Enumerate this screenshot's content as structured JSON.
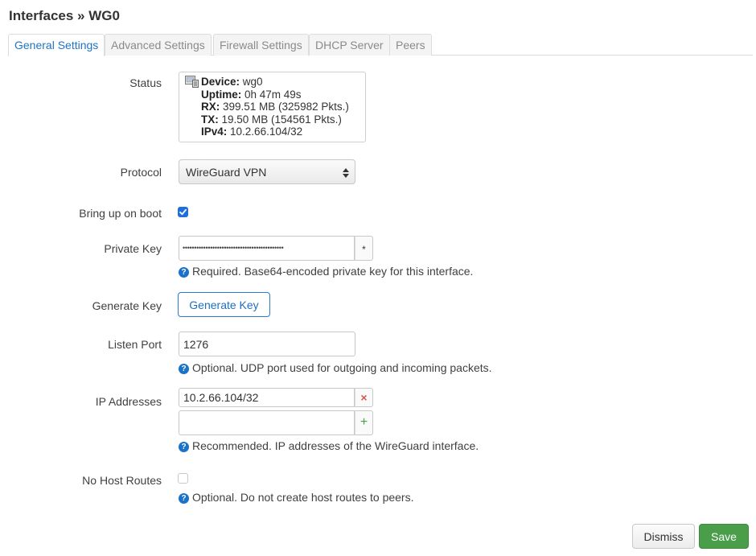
{
  "page": {
    "title": "Interfaces » WG0"
  },
  "tabs": [
    {
      "label": "General Settings",
      "active": true
    },
    {
      "label": "Advanced Settings",
      "active": false
    },
    {
      "label": "Firewall Settings",
      "active": false
    },
    {
      "label": "DHCP Server",
      "active": false
    },
    {
      "label": "Peers",
      "active": false
    }
  ],
  "status": {
    "label": "Status",
    "device_key": "Device:",
    "device_value": " wg0",
    "uptime_key": "Uptime:",
    "uptime_value": " 0h 47m 49s",
    "rx_key": "RX:",
    "rx_value": " 399.51 MB (325982 Pkts.)",
    "tx_key": "TX:",
    "tx_value": " 19.50 MB (154561 Pkts.)",
    "ipv4_key": "IPv4:",
    "ipv4_value": " 10.2.66.104/32",
    "icon": "network-device-icon"
  },
  "protocol": {
    "label": "Protocol",
    "selected": "WireGuard VPN"
  },
  "bring_up_on_boot": {
    "label": "Bring up on boot",
    "checked": true
  },
  "private_key": {
    "label": "Private Key",
    "masked_value": "••••••••••••••••••••••••••••••••••••••••••••",
    "reveal_symbol": "*",
    "help": "Required. Base64-encoded private key for this interface."
  },
  "generate_key": {
    "label": "Generate Key",
    "button_label": "Generate Key"
  },
  "listen_port": {
    "label": "Listen Port",
    "value": "1276",
    "help": "Optional. UDP port used for outgoing and incoming packets."
  },
  "ip_addresses": {
    "label": "IP Addresses",
    "entries": [
      "10.2.66.104/32"
    ],
    "new_entry": "",
    "remove_symbol": "×",
    "add_symbol": "+",
    "help": "Recommended. IP addresses of the WireGuard interface."
  },
  "no_host_routes": {
    "label": "No Host Routes",
    "checked": false,
    "help": "Optional. Do not create host routes to peers."
  },
  "footer": {
    "dismiss_label": "Dismiss",
    "save_label": "Save"
  },
  "help_symbol": "?",
  "colors": {
    "accent": "#1f74c4",
    "save": "#4a9e4a",
    "remove": "#d9534f",
    "add": "#4a9e4a"
  }
}
